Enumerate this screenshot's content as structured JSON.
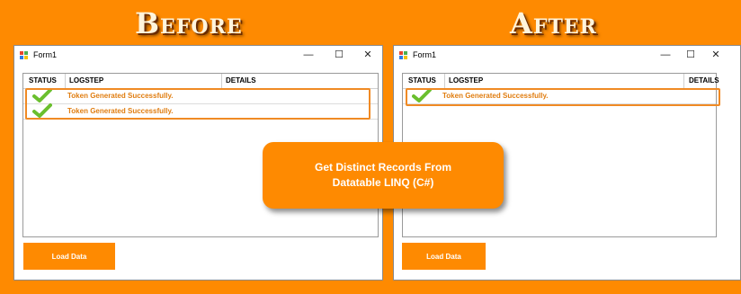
{
  "headings": {
    "before": "Before",
    "after": "After"
  },
  "windows": {
    "before": {
      "title": "Form1",
      "controls": {
        "minimize": "—",
        "maximize": "☐",
        "close": "✕"
      },
      "columns": [
        "STATUS",
        "LOGSTEP",
        "DETAILS"
      ],
      "rows": [
        {
          "status_icon": "check-icon",
          "logstep": "Token Generated Successfully.",
          "details": ""
        },
        {
          "status_icon": "check-icon",
          "logstep": "Token Generated Successfully.",
          "details": ""
        }
      ],
      "button_label": "Load Data"
    },
    "after": {
      "title": "Form1",
      "controls": {
        "minimize": "—",
        "maximize": "☐",
        "close": "✕"
      },
      "columns": [
        "STATUS",
        "LOGSTEP",
        "DETAILS"
      ],
      "rows": [
        {
          "status_icon": "check-icon",
          "logstep": "Token Generated Successfully.",
          "details": ""
        }
      ],
      "button_label": "Load Data"
    }
  },
  "callout": {
    "line1": "Get Distinct Records From",
    "line2": "Datatable LINQ (C#)"
  },
  "colors": {
    "background": "#fe8a01",
    "highlight": "#f08a24",
    "row_text": "#e07d10",
    "check": "#6abf2e"
  }
}
